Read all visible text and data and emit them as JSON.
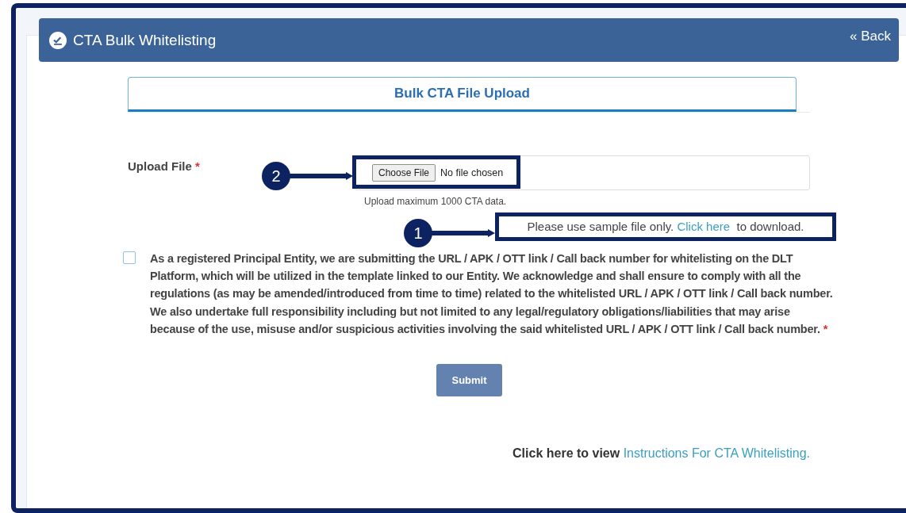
{
  "header": {
    "title": "CTA Bulk Whitelisting",
    "back": "« Back"
  },
  "tabs": [
    {
      "label": "Bulk CTA File Upload",
      "selected": true
    }
  ],
  "upload": {
    "label": "Upload File",
    "required_mark": "*",
    "button": "Choose File",
    "status": "No file chosen",
    "hint": "Upload maximum 1000 CTA data."
  },
  "sample_note": {
    "before": "Please use sample file only.",
    "link": "Click here",
    "after": "to download."
  },
  "consent": {
    "checked": false,
    "text": "As a registered Principal Entity, we are submitting the URL / APK / OTT link / Call back number for whitelisting on the DLT Platform, which will be utilized in the template linked to our Entity. We acknowledge and shall ensure to comply with all the regulations (as may be amended/introduced from time to time) related to the whitelisted URL / APK / OTT link / Call back number. We also undertake full responsibility including but not limited to any legal/regulatory obligations/liabilities that may arise because of the use, misuse and/or suspicious activities involving the said whitelisted URL / APK / OTT link / Call back number.",
    "required_mark": "*"
  },
  "submit": {
    "label": "Submit",
    "disabled": true
  },
  "footer": {
    "text": "Click here to view",
    "link": "Instructions For CTA Whitelisting."
  },
  "annotations": [
    {
      "number": "1",
      "kind": "sample"
    },
    {
      "number": "2",
      "kind": "file"
    }
  ]
}
